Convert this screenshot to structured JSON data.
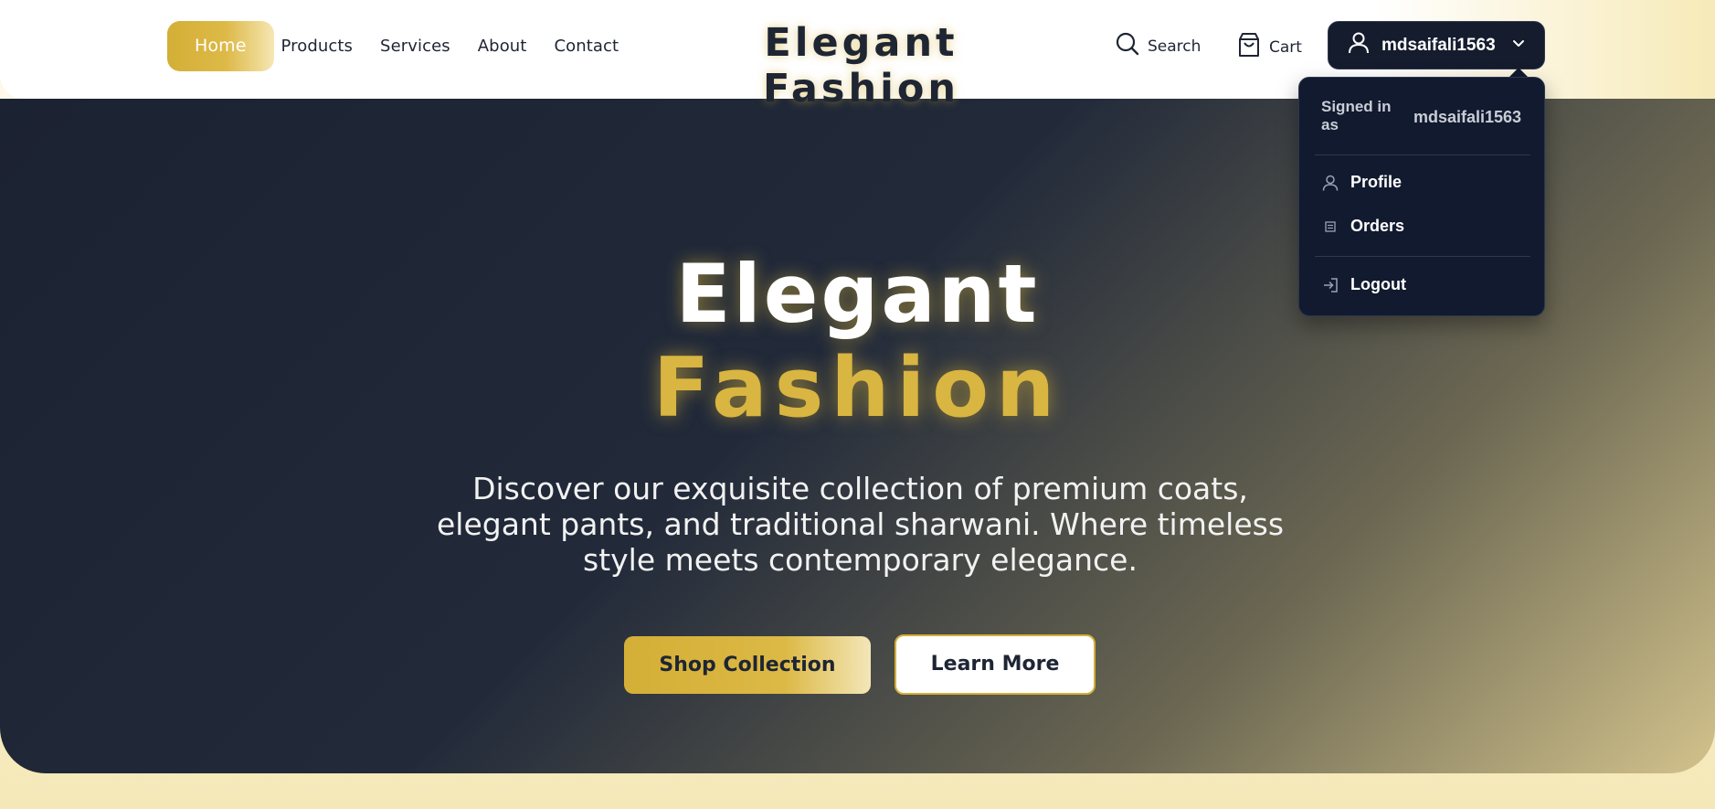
{
  "header": {
    "nav": [
      {
        "label": "Home",
        "active": true
      },
      {
        "label": "Products"
      },
      {
        "label": "Services"
      },
      {
        "label": "About"
      },
      {
        "label": "Contact"
      }
    ],
    "brand": "Elegant Fashion",
    "search_label": "Search",
    "cart_label": "Cart",
    "username": "mdsaifali1563"
  },
  "dropdown": {
    "signed_in_label": "Signed in as",
    "username": "mdsaifali1563",
    "items": [
      {
        "label": "Profile",
        "icon": "user-icon"
      },
      {
        "label": "Orders",
        "icon": "list-icon"
      },
      {
        "label": "Logout",
        "icon": "logout-icon"
      }
    ]
  },
  "hero": {
    "title_line1": "Elegant",
    "title_line2": "Fashion",
    "description": "Discover our exquisite collection of premium coats, elegant pants, and traditional sharwani. Where timeless style meets contemporary elegance.",
    "primary_button": "Shop Collection",
    "secondary_button": "Learn More"
  },
  "colors": {
    "accent_gold": "#d4af37",
    "dark_navy": "#1e2533",
    "dropdown_bg": "#111a2e"
  }
}
